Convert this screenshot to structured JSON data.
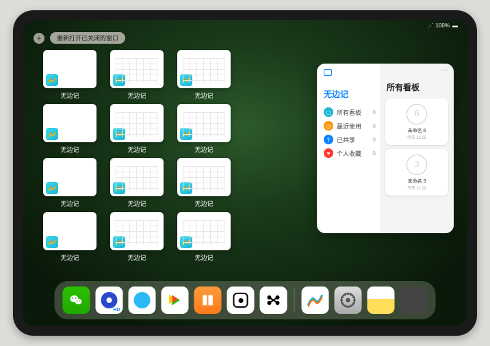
{
  "status": {
    "battery": "100%",
    "wifi": "●"
  },
  "topbar": {
    "plus": "+",
    "pill_label": "重新打开已关闭的窗口"
  },
  "app_name": "无边记",
  "windows": [
    {
      "label": "无边记",
      "variant": "blank"
    },
    {
      "label": "无边记",
      "variant": "calendar"
    },
    {
      "label": "无边记",
      "variant": "calendar"
    },
    {
      "label": "无边记",
      "variant": "blank"
    },
    {
      "label": "无边记",
      "variant": "calendar"
    },
    {
      "label": "无边记",
      "variant": "calendar"
    },
    {
      "label": "无边记",
      "variant": "blank"
    },
    {
      "label": "无边记",
      "variant": "calendar"
    },
    {
      "label": "无边记",
      "variant": "calendar"
    },
    {
      "label": "无边记",
      "variant": "blank"
    },
    {
      "label": "无边记",
      "variant": "calendar"
    },
    {
      "label": "无边记",
      "variant": "calendar"
    }
  ],
  "float": {
    "more": "···",
    "left_title": "无边记",
    "right_title": "所有看板",
    "items": [
      {
        "label": "所有看板",
        "count": "0",
        "color": "#1fb5d6",
        "glyph": "◻"
      },
      {
        "label": "最近使用",
        "count": "0",
        "color": "#ff9500",
        "glyph": "◷"
      },
      {
        "label": "已共享",
        "count": "0",
        "color": "#0a84ff",
        "glyph": "⇪"
      },
      {
        "label": "个人收藏",
        "count": "0",
        "color": "#ff3b30",
        "glyph": "♥"
      }
    ],
    "boards": [
      {
        "scribble": "6",
        "title": "未命名 6",
        "sub": "今天 11:25"
      },
      {
        "scribble": "3",
        "title": "未命名 3",
        "sub": "今天 11:20"
      }
    ]
  },
  "dock": {
    "icons": [
      {
        "id": "wechat",
        "name": "WeChat"
      },
      {
        "id": "qqblue",
        "name": "Tencent Video HD"
      },
      {
        "id": "qqlight",
        "name": "QQ Browser"
      },
      {
        "id": "video",
        "name": "Video Player"
      },
      {
        "id": "books",
        "name": "Books"
      },
      {
        "id": "dot",
        "name": "App"
      },
      {
        "id": "bowtie",
        "name": "App"
      },
      {
        "id": "freeform",
        "name": "Freeform"
      },
      {
        "id": "settings",
        "name": "Settings"
      },
      {
        "id": "notes",
        "name": "Notes"
      },
      {
        "id": "folder",
        "name": "App Library"
      }
    ],
    "hd_badge": "HD"
  }
}
